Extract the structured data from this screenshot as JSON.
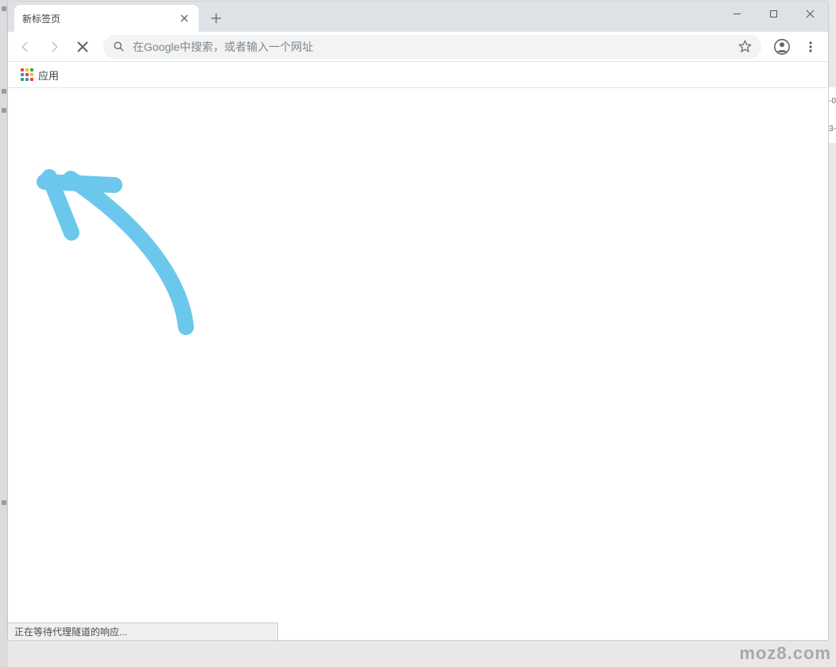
{
  "window": {
    "minimize_tip": "最小化",
    "maximize_tip": "最大化",
    "close_tip": "关闭"
  },
  "tabs": {
    "active": {
      "title": "新标签页"
    },
    "close_label": "关闭标签页",
    "new_tab_label": "打开新的标签页"
  },
  "toolbar": {
    "back_label": "返回",
    "forward_label": "前进",
    "stop_label": "停止",
    "omnibox_placeholder": "在Google中搜索，或者输入一个网址",
    "omnibox_value": "",
    "star_label": "为此页添加书签",
    "profile_label": "用户",
    "menu_label": "自定义及控制 Google Chrome"
  },
  "bookmark_bar": {
    "apps_label": "应用"
  },
  "status_bar": {
    "text": "正在等待代理隧道的响应..."
  },
  "right_peek": {
    "line1": "-0",
    "line2": "3-"
  },
  "watermark": "moz8.com",
  "annotation": {
    "color": "#6cc7ec",
    "description": "hand-drawn-arrow"
  },
  "apps_grid_colors": [
    "#ea4335",
    "#fbbc05",
    "#34a853",
    "#4285f4",
    "#ea4335",
    "#fbbc05",
    "#34a853",
    "#4285f4",
    "#ea4335"
  ]
}
